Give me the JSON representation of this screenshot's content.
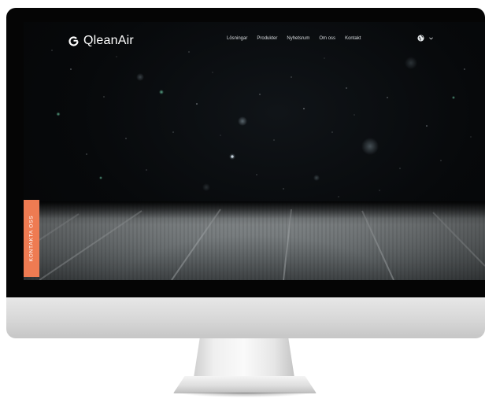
{
  "site": {
    "brand": "QleanAir",
    "nav": [
      {
        "label": "Lösningar"
      },
      {
        "label": "Produkter"
      },
      {
        "label": "Nyhetsrum"
      },
      {
        "label": "Om oss"
      },
      {
        "label": "Kontakt"
      }
    ],
    "language_icon": "globe-icon",
    "language_dropdown_icon": "chevron-down-icon",
    "contact_tab": "KONTAKTA OSS"
  },
  "colors": {
    "accent": "#ee7b52",
    "background": "#07090b",
    "nav_text": "#d9dde0"
  }
}
